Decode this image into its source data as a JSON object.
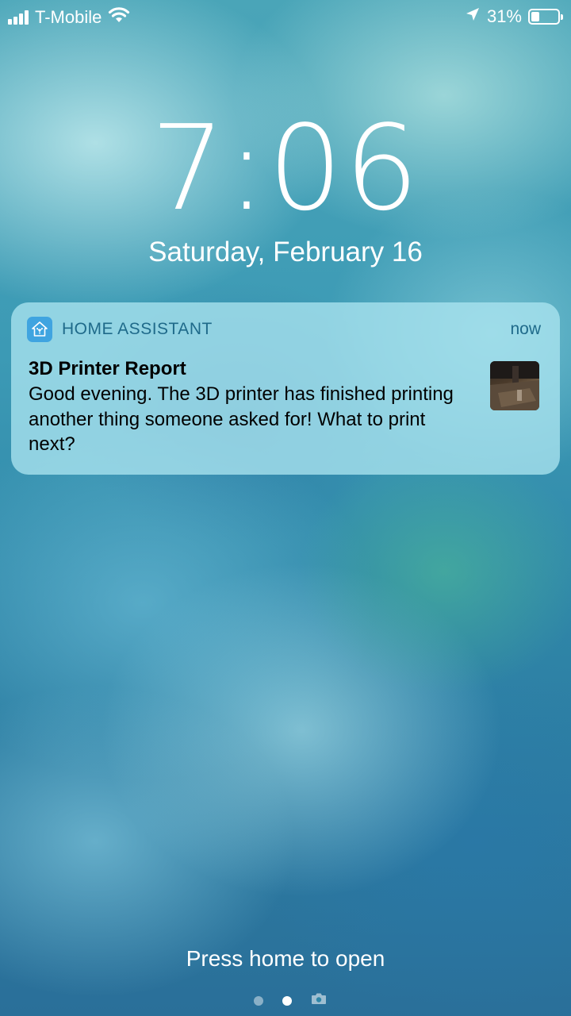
{
  "status_bar": {
    "carrier": "T-Mobile",
    "signal_bars": 4,
    "wifi_icon": "wifi-icon",
    "location_icon": "location-arrow-icon",
    "battery_percent": "31%",
    "battery_level": 0.31
  },
  "lock_screen": {
    "time": "7:06",
    "date": "Saturday, February 16",
    "press_home": "Press home to open"
  },
  "notification": {
    "app_icon": "home-assistant-icon",
    "app_name": "HOME ASSISTANT",
    "time": "now",
    "title": "3D Printer Report",
    "body": "Good evening.  The 3D printer has finished printing another thing someone asked for!  What to print next?",
    "thumbnail": "printer-photo-thumbnail"
  },
  "page_indicator": {
    "pages": 2,
    "active_index": 1,
    "camera_icon": "camera-icon"
  },
  "colors": {
    "notification_bg": "#AAE4F0",
    "app_name_color": "#1F6A8A",
    "app_icon_bg": "#3FA4E0"
  }
}
